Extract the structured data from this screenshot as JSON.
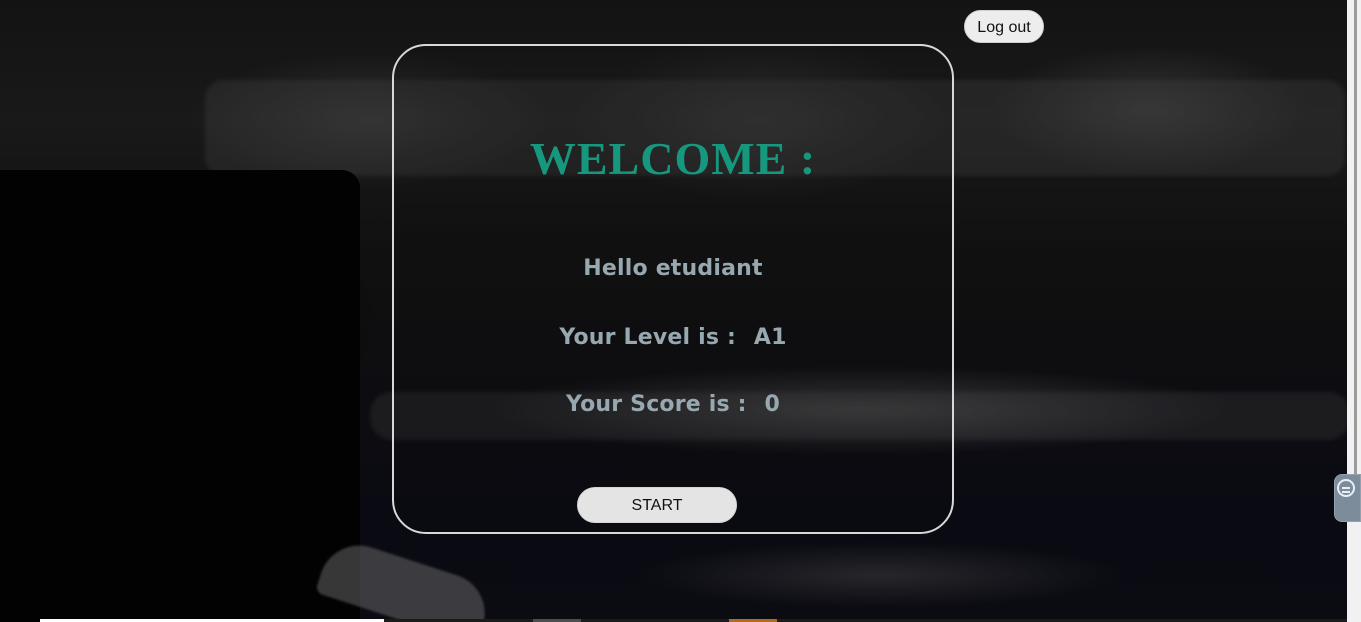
{
  "header": {
    "logout_label": "Log out"
  },
  "main": {
    "title": "WELCOME :",
    "greeting_prefix": "Hello",
    "username": "etudiant",
    "level_label": "Your Level is :",
    "level_value": "A1",
    "score_label": "Your Score is :",
    "score_value": "0",
    "start_label": "START"
  },
  "icons": {
    "side_widget": "remote-control-icon"
  },
  "colors": {
    "title": "#16987e",
    "info_text": "#98a8b0",
    "button_bg": "#e4e4e4",
    "card_border": "#d8d8d8"
  }
}
